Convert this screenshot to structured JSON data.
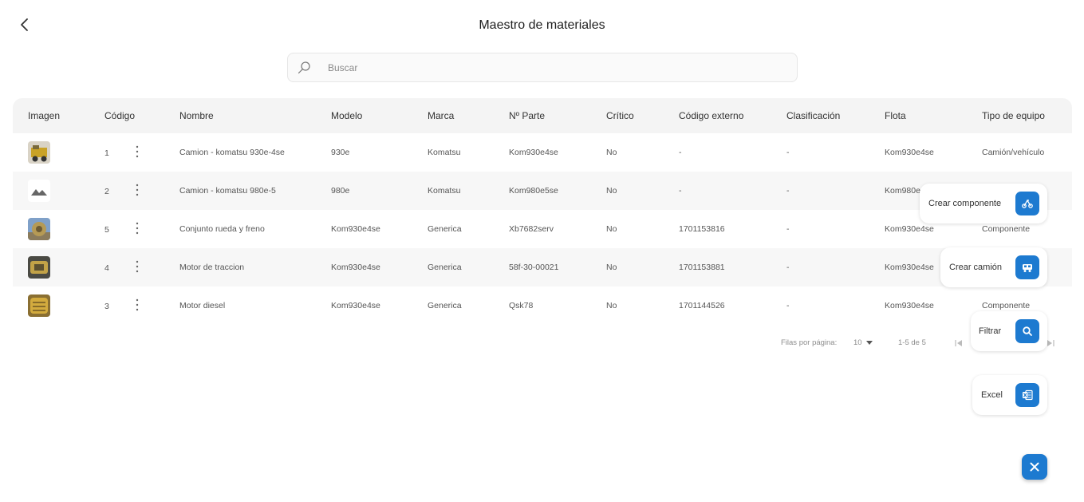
{
  "header": {
    "title": "Maestro de materiales"
  },
  "search": {
    "placeholder": "Buscar",
    "value": ""
  },
  "table": {
    "columns": [
      "Imagen",
      "Código",
      "Nombre",
      "Modelo",
      "Marca",
      "Nº Parte",
      "Crítico",
      "Código externo",
      "Clasificación",
      "Flota",
      "Tipo de equipo"
    ],
    "rows": [
      {
        "codigo": "1",
        "nombre": "Camion - komatsu 930e-4se",
        "modelo": "930e",
        "marca": "Komatsu",
        "parte": "Kom930e4se",
        "critico": "No",
        "externo": "-",
        "clasificacion": "-",
        "flota": "Kom930e4se",
        "tipo": "Camión/vehículo"
      },
      {
        "codigo": "2",
        "nombre": "Camion - komatsu 980e-5",
        "modelo": "980e",
        "marca": "Komatsu",
        "parte": "Kom980e5se",
        "critico": "No",
        "externo": "-",
        "clasificacion": "-",
        "flota": "Kom980e",
        "tipo": ""
      },
      {
        "codigo": "5",
        "nombre": "Conjunto rueda y freno",
        "modelo": "Kom930e4se",
        "marca": "Generica",
        "parte": "Xb7682serv",
        "critico": "No",
        "externo": "1701153816",
        "clasificacion": "-",
        "flota": "Kom930e4se",
        "tipo": "Componente"
      },
      {
        "codigo": "4",
        "nombre": "Motor de traccion",
        "modelo": "Kom930e4se",
        "marca": "Generica",
        "parte": "58f-30-00021",
        "critico": "No",
        "externo": "1701153881",
        "clasificacion": "-",
        "flota": "Kom930e4se",
        "tipo": ""
      },
      {
        "codigo": "3",
        "nombre": "Motor diesel",
        "modelo": "Kom930e4se",
        "marca": "Generica",
        "parte": "Qsk78",
        "critico": "No",
        "externo": "1701144526",
        "clasificacion": "-",
        "flota": "Kom930e4se",
        "tipo": "Componente"
      }
    ]
  },
  "pagination": {
    "rows_label": "Filas por página:",
    "rows_value": "10",
    "range": "1-5 de 5"
  },
  "speed_dial": {
    "actions": [
      {
        "label": "Crear componente",
        "icon": "component-icon"
      },
      {
        "label": "Crear camión",
        "icon": "truck-icon"
      },
      {
        "label": "Filtrar",
        "icon": "search-icon"
      },
      {
        "label": "Excel",
        "icon": "excel-icon"
      }
    ],
    "close_icon": "close-icon"
  },
  "colors": {
    "accent": "#1d7ad0",
    "header_bg": "#f4f4f4",
    "row_alt": "#f7f7f7"
  }
}
